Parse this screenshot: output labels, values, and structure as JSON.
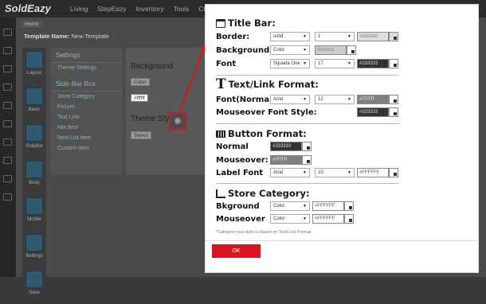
{
  "app": {
    "logo": "SoldEazy",
    "nav": [
      "Living",
      "StepEazy",
      "Inventory",
      "Tools",
      "Channel"
    ],
    "crumb": "Home",
    "template_label": "Template Name:",
    "template_value": "New Template"
  },
  "left_tools": [
    "Layout",
    "Basic",
    "SideBar",
    "Body",
    "Mobile",
    "Settings",
    "Save"
  ],
  "settings_panel": {
    "heading": "Settings",
    "theme_settings": "Theme Settings",
    "sidebar_heading": "Side-Bar Box",
    "items": [
      "Store Category",
      "Picture",
      "Text Link",
      "Hot Item",
      "New List Item",
      "Custom Item"
    ]
  },
  "props_panel": {
    "background_label": "Background",
    "background_select": "Color",
    "background_value": "#ffffff",
    "theme_style_label": "Theme Style",
    "theme_style_select": "Select"
  },
  "modal": {
    "title_bar": {
      "heading": "Title Bar:",
      "border_label": "Border:",
      "border_style": "solid",
      "border_width": "1",
      "border_color": "#dddddd",
      "background_label": "Background",
      "background_select": "Color",
      "background_color": "#cccccc",
      "font_label": "Font",
      "font_family": "Squada One",
      "font_size": "17",
      "font_color": "#333333"
    },
    "text_link": {
      "heading": "Text/Link Format:",
      "font_normal_label": "Font(Normal)",
      "font_family": "Arial",
      "font_size": "12",
      "font_color": "#7f7f7f",
      "mouseover_label": "Mouseover Font Style:",
      "mouseover_color": "#333333"
    },
    "button_format": {
      "heading": "Button Format:",
      "normal_label": "Normal",
      "normal_color": "#333333",
      "mouseover_label": "Mouseover:",
      "mouseover_color": "#7f7f7f",
      "label_font_label": "Label Font",
      "label_font_family": "Arial",
      "label_font_size": "10",
      "label_font_color": "#FFFFFF"
    },
    "store_category": {
      "heading": "Store Category:",
      "bkground_label": "Bkground",
      "bkground_select": "Color",
      "bkground_color": "#FFFFFF",
      "mouseover_label": "Mouseover",
      "mouseover_select": "Color",
      "mouseover_color": "#FFFFFF"
    },
    "note": "*Category text style is based on Text/Link Format",
    "ok_label": "OK"
  },
  "colors": {
    "accent": "#d9141e",
    "dark_swatch": "#333333",
    "gray_swatch": "#7f7f7f",
    "light_swatch": "#dddddd",
    "mid_swatch": "#cccccc"
  }
}
